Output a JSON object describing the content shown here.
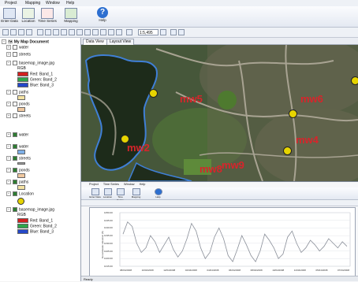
{
  "menu": [
    "Project",
    "Mapping",
    "Window",
    "Help"
  ],
  "toolbar": [
    {
      "label": "Enter Data",
      "icon": "table-icon"
    },
    {
      "label": "Location",
      "icon": "location-icon"
    },
    {
      "label": "Time Series",
      "icon": "time-series-icon"
    },
    {
      "label": "Mapping",
      "icon": "mapping-icon"
    },
    {
      "label": "Help",
      "icon": "help-icon"
    }
  ],
  "scale": "1:5,495",
  "toc": {
    "title": "My Map Document",
    "rgb": "RGB",
    "bands": [
      "Red: Band_1",
      "Green: Band_2",
      "Blue: Band_3"
    ],
    "layers1": [
      "water",
      "streets",
      "basemap_image.jpg",
      "paths",
      "ponds",
      "streets"
    ],
    "layers2": [
      "water",
      "water",
      "streets",
      "ponds",
      "paths",
      "Location",
      "basemap_image.jpg"
    ],
    "colors": {
      "red": "#d32020",
      "green": "#2ea64a",
      "blue": "#2548c8"
    }
  },
  "tabs": [
    "Data View",
    "Layout View"
  ],
  "map_labels": [
    "mw5",
    "mw2",
    "mw6",
    "mw4",
    "mw8",
    "mw9"
  ],
  "inner_menu": [
    "Project",
    "Time Series",
    "Window",
    "Help"
  ],
  "inner_toolbar": [
    "Enter Data",
    "Location",
    "Time Series",
    "Mapping",
    "Help"
  ],
  "chart_data": {
    "type": "line",
    "ylabel": "Groundwater elevation (ft)",
    "y_ticks": [
      "1050.00",
      "1045.00",
      "1040.00",
      "1035.00",
      "1030.00",
      "1025.00",
      "1020.00",
      "1015.00"
    ],
    "x_ticks": [
      "08/04/2008",
      "10/04/2008",
      "12/04/2008",
      "02/04/2008",
      "04/04/2008",
      "06/04/2008",
      "08/04/2008",
      "10/04/2008",
      "12/04/2008",
      "05/04/2008",
      "07/04/2008"
    ],
    "ylim": [
      1015,
      1050
    ],
    "series": [
      {
        "values": [
          1036,
          1044,
          1041,
          1030,
          1024,
          1027,
          1035,
          1031,
          1024,
          1029,
          1034,
          1026,
          1021,
          1025,
          1033,
          1043,
          1038,
          1027,
          1020,
          1024,
          1034,
          1040,
          1033,
          1022,
          1018,
          1026,
          1035,
          1029,
          1022,
          1018,
          1025,
          1036,
          1032,
          1027,
          1020,
          1023,
          1034,
          1038,
          1030,
          1024,
          1027,
          1032,
          1029,
          1025,
          1028,
          1033,
          1030,
          1027,
          1031,
          1028
        ]
      }
    ]
  },
  "status": "Ready"
}
